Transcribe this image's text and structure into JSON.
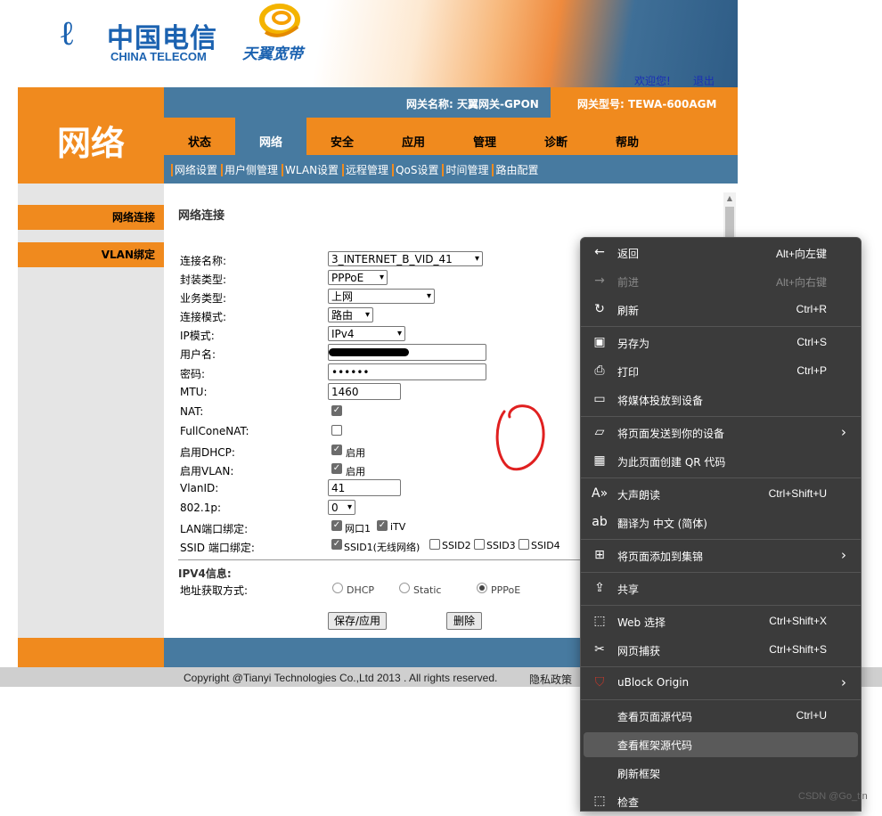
{
  "header": {
    "logo_glyph": "ℓ",
    "logo_cn": "中国电信",
    "logo_en": "CHINA TELECOM",
    "logo2": "天翼宽带",
    "welcome": "欢迎您!",
    "logout": "退出",
    "section_title": "网络",
    "gateway_name": "网关名称:  天翼网关-GPON",
    "gateway_model": "网关型号: TEWA-600AGM"
  },
  "tabs": [
    "状态",
    "网络",
    "安全",
    "应用",
    "管理",
    "诊断",
    "帮助"
  ],
  "subnav": [
    "网络设置",
    "用户侧管理",
    "WLAN设置",
    "远程管理",
    "QoS设置",
    "时间管理",
    "路由配置"
  ],
  "sidebar": [
    "网络连接",
    "VLAN绑定"
  ],
  "content": {
    "title": "网络连接",
    "fields": {
      "conn_name_label": "连接名称:",
      "conn_name": "3_INTERNET_B_VID_41",
      "encap_label": "封装类型:",
      "encap": "PPPoE",
      "service_label": "业务类型:",
      "service": "上网",
      "mode_label": "连接模式:",
      "mode": "路由",
      "ip_mode_label": "IP模式:",
      "ip_mode": "IPv4",
      "user_label": "用户名:",
      "user": "",
      "pwd_label": "密码:",
      "pwd": "••••••",
      "mtu_label": "MTU:",
      "mtu": "1460",
      "nat_label": "NAT:",
      "fullcone_label": "FullConeNAT:",
      "dhcp_label": "启用DHCP:",
      "dhcp_text": "启用",
      "vlan_label": "启用VLAN:",
      "vlan_text": "启用",
      "vlanid_label": "VlanID:",
      "vlanid": "41",
      "p8021_label": "802.1p:",
      "p8021": "0",
      "lan_bind_label": "LAN端口绑定:",
      "lan1": "网口1",
      "itv": "iTV",
      "ssid_bind_label": "SSID 端口绑定:",
      "ssid1": "SSID1(无线网络)",
      "ssid2": "SSID2",
      "ssid3": "SSID3",
      "ssid4": "SSID4"
    },
    "ipv4_title": "IPV4信息:",
    "addr_label": "地址获取方式:",
    "addr_options": [
      "DHCP",
      "Static",
      "PPPoE"
    ],
    "save_btn": "保存/应用",
    "delete_btn": "删除"
  },
  "footer": {
    "copyright": "Copyright @Tianyi Technologies Co.,Ltd 2013 . All rights reserved.",
    "privacy": "隐私政策"
  },
  "context_menu": {
    "back": "返回",
    "back_sc": "Alt+向左键",
    "forward": "前进",
    "forward_sc": "Alt+向右键",
    "refresh": "刷新",
    "refresh_sc": "Ctrl+R",
    "save_as": "另存为",
    "save_as_sc": "Ctrl+S",
    "print": "打印",
    "print_sc": "Ctrl+P",
    "cast": "将媒体投放到设备",
    "send_page": "将页面发送到你的设备",
    "qr": "为此页面创建 QR 代码",
    "read_aloud": "大声朗读",
    "read_aloud_sc": "Ctrl+Shift+U",
    "translate": "翻译为 中文 (简体)",
    "collections": "将页面添加到集锦",
    "share": "共享",
    "web_select": "Web 选择",
    "web_select_sc": "Ctrl+Shift+X",
    "web_capture": "网页捕获",
    "web_capture_sc": "Ctrl+Shift+S",
    "ublock": "uBlock Origin",
    "view_source": "查看页面源代码",
    "view_source_sc": "Ctrl+U",
    "view_frame_source": "查看框架源代码",
    "refresh_frame": "刷新框架",
    "inspect": "检查"
  },
  "watermark": "CSDN @Go_tin"
}
